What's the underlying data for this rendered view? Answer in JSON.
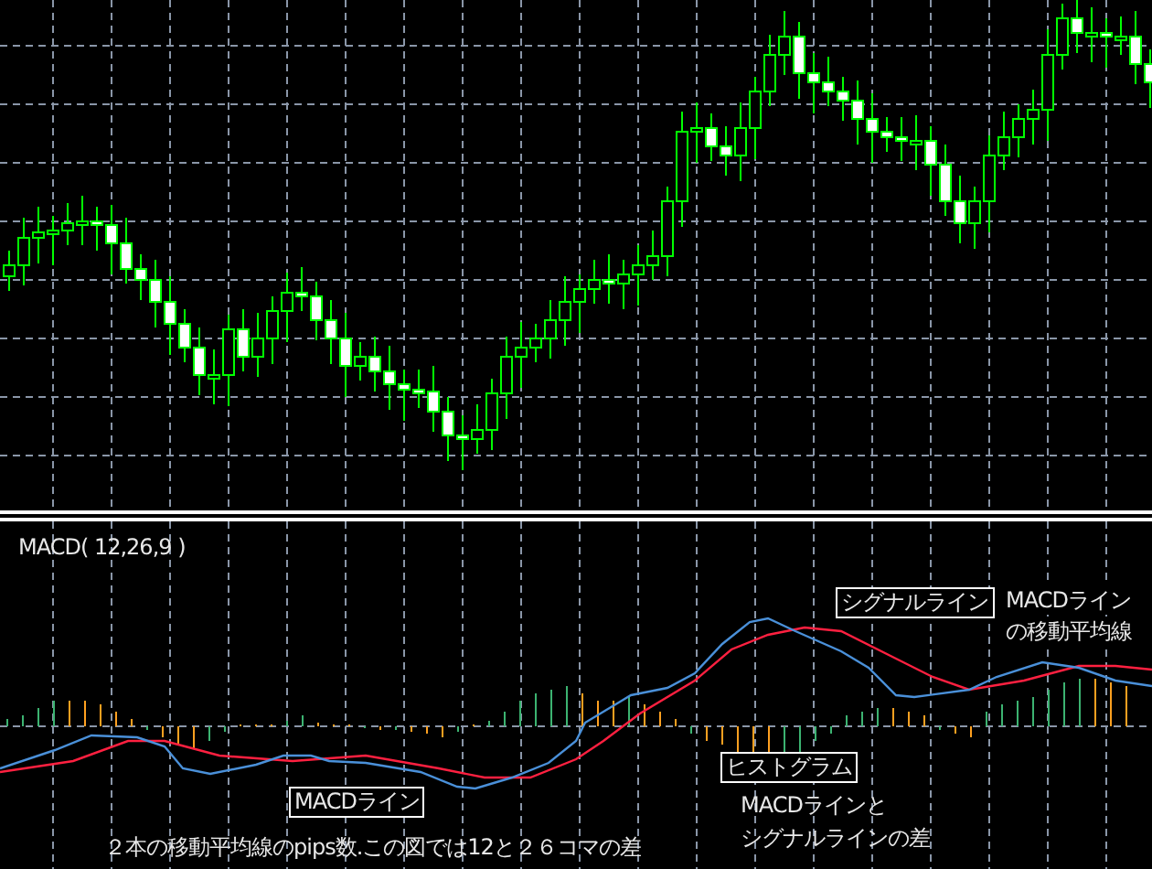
{
  "indicator_label": "MACD( 12,26,9 )",
  "signal_line": {
    "label": "シグナルライン",
    "note": [
      "MACDライン",
      "の移動平均線"
    ]
  },
  "histogram": {
    "label": "ヒストグラム",
    "note": [
      "MACDラインと",
      "シグナルラインの差"
    ]
  },
  "macd_line": {
    "label": "MACDライン",
    "note": "２本の移動平均線のpips数.この図では12と２６コマの差"
  }
}
